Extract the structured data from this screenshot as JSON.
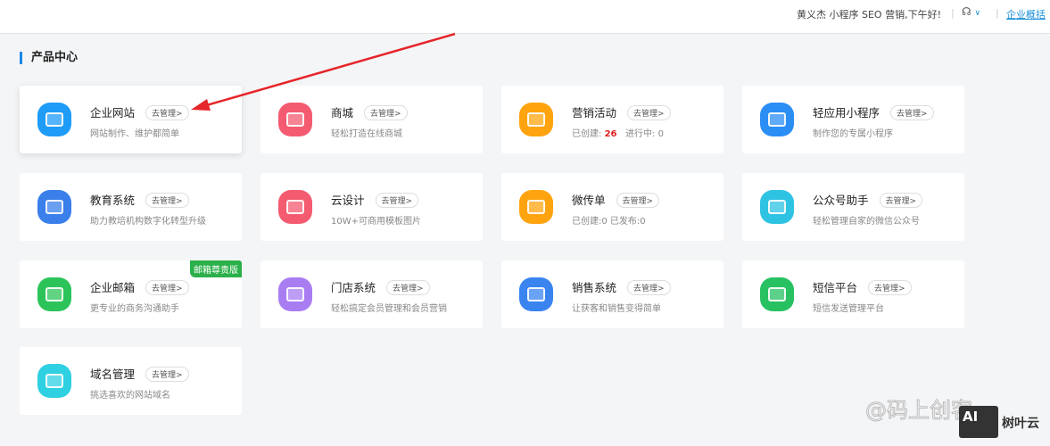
{
  "header": {
    "greeting": "黄义杰 小程序 SEO 营销,下午好!",
    "headset_icon": "headset-icon",
    "overview_link": "企业概括"
  },
  "section_title": "产品中心",
  "manage_label": "去管理>",
  "cards": [
    {
      "title": "企业网站",
      "desc": "网站制作、维护都简单",
      "color": "#1e9cf8"
    },
    {
      "title": "商城",
      "desc": "轻松打造在线商城",
      "color": "#f45b71"
    },
    {
      "title": "营销活动",
      "desc_prefix": "已创建:",
      "created": "26",
      "desc_mid": "进行中:",
      "running": "0",
      "color": "#ffa40f"
    },
    {
      "title": "轻应用小程序",
      "desc": "制作您的专属小程序",
      "color": "#2b8ef5"
    },
    {
      "title": "教育系统",
      "desc": "助力教培机构数字化转型升级",
      "color": "#3a7fea"
    },
    {
      "title": "云设计",
      "desc": "10W+可商用模板图片",
      "color": "#f45b71"
    },
    {
      "title": "微传单",
      "desc": "已创建:0   已发布:0",
      "color": "#ffa40f"
    },
    {
      "title": "公众号助手",
      "desc": "轻松管理自家的微信公众号",
      "color": "#2ec3e3"
    },
    {
      "title": "企业邮箱",
      "desc": "更专业的商务沟通助手",
      "color": "#2cc45a",
      "badge": "邮箱尊贵版"
    },
    {
      "title": "门店系统",
      "desc": "轻松搞定会员管理和会员营销",
      "color": "#a97df2"
    },
    {
      "title": "销售系统",
      "desc": "让获客和销售变得简单",
      "color": "#3a84f0"
    },
    {
      "title": "短信平台",
      "desc": "短信发送管理平台",
      "color": "#27c162"
    },
    {
      "title": "域名管理",
      "desc": "挑选喜欢的网站域名",
      "color": "#2ed0e2"
    }
  ],
  "watermark": {
    "baidu": "@码上创客",
    "ai_logo": "AI",
    "ai_brand": "树叶云"
  }
}
